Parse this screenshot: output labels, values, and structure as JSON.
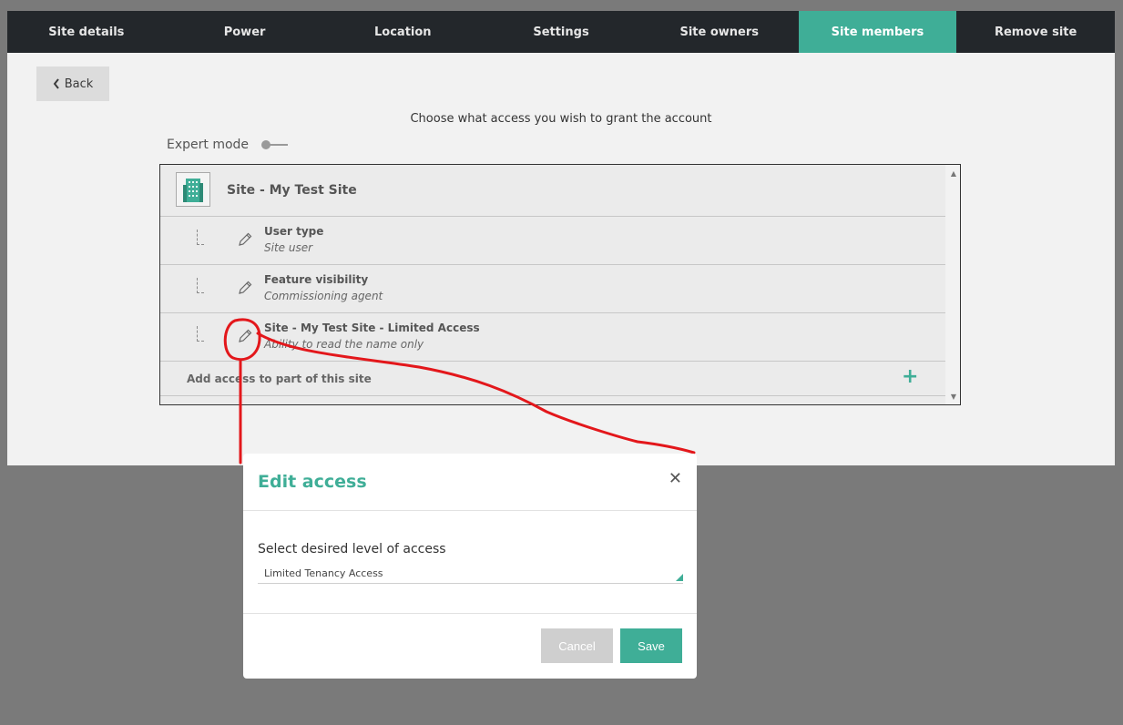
{
  "tabs": [
    {
      "label": "Site details"
    },
    {
      "label": "Power"
    },
    {
      "label": "Location"
    },
    {
      "label": "Settings"
    },
    {
      "label": "Site owners"
    },
    {
      "label": "Site members",
      "active": true
    },
    {
      "label": "Remove site"
    }
  ],
  "back": {
    "icon": "chevron-left-icon",
    "label": "Back"
  },
  "prompt": "Choose what access you wish to grant the account",
  "expert_mode": {
    "label": "Expert mode",
    "enabled": false
  },
  "site": {
    "icon": "building-icon",
    "title": "Site - My Test Site",
    "rows": [
      {
        "title": "User type",
        "subtitle": "Site user"
      },
      {
        "title": "Feature visibility",
        "subtitle": "Commissioning agent"
      },
      {
        "title": "Site - My Test Site - Limited Access",
        "subtitle": "Ability to read the name only"
      }
    ],
    "add_label": "Add access to part of this site",
    "add_icon": "plus-icon"
  },
  "modal": {
    "title": "Edit access",
    "close_icon": "close-icon",
    "select_label": "Select desired level of access",
    "select_value": "Limited Tenancy Access",
    "cancel_label": "Cancel",
    "save_label": "Save"
  },
  "colors": {
    "accent": "#3fae97",
    "nav_bg": "#23272b",
    "annotation": "#e3171b"
  }
}
